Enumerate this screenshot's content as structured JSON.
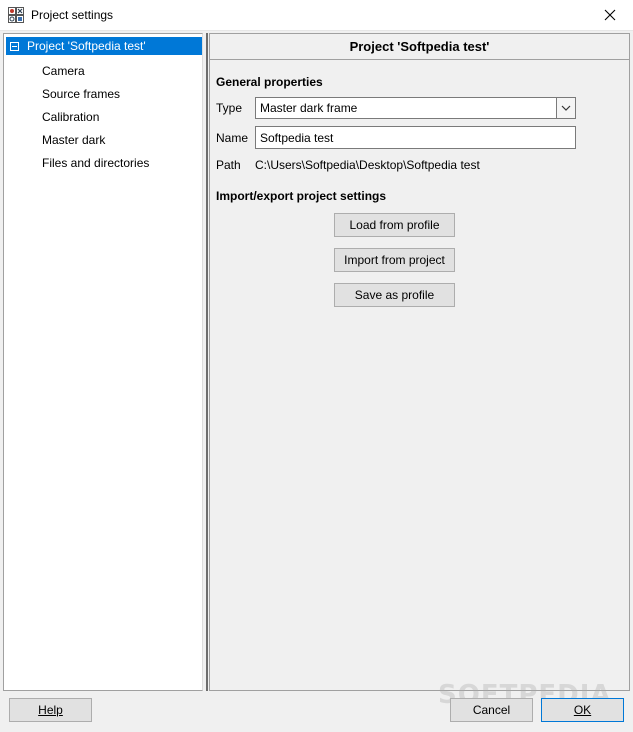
{
  "window": {
    "title": "Project settings",
    "icon": "settings-grid-icon",
    "close_glyph": "✕"
  },
  "tree": {
    "root_label": "Project 'Softpedia test'",
    "items": [
      "Camera",
      "Source frames",
      "Calibration",
      "Master dark",
      "Files and directories"
    ]
  },
  "panel": {
    "header": "Project 'Softpedia test'",
    "general_title": "General properties",
    "type_label": "Type",
    "type_value": "Master dark frame",
    "name_label": "Name",
    "name_value": "Softpedia test",
    "path_label": "Path",
    "path_value": "C:\\Users\\Softpedia\\Desktop\\Softpedia test",
    "import_title": "Import/export project settings",
    "buttons": {
      "load": "Load from profile",
      "import": "Import from project",
      "save": "Save as profile"
    }
  },
  "footer": {
    "help": "Help",
    "cancel": "Cancel",
    "ok": "OK",
    "watermark": "SOFTPEDIA"
  },
  "colors": {
    "selection": "#0078d7",
    "window_bg": "#f0f0f0",
    "button_bg": "#e1e1e1"
  }
}
